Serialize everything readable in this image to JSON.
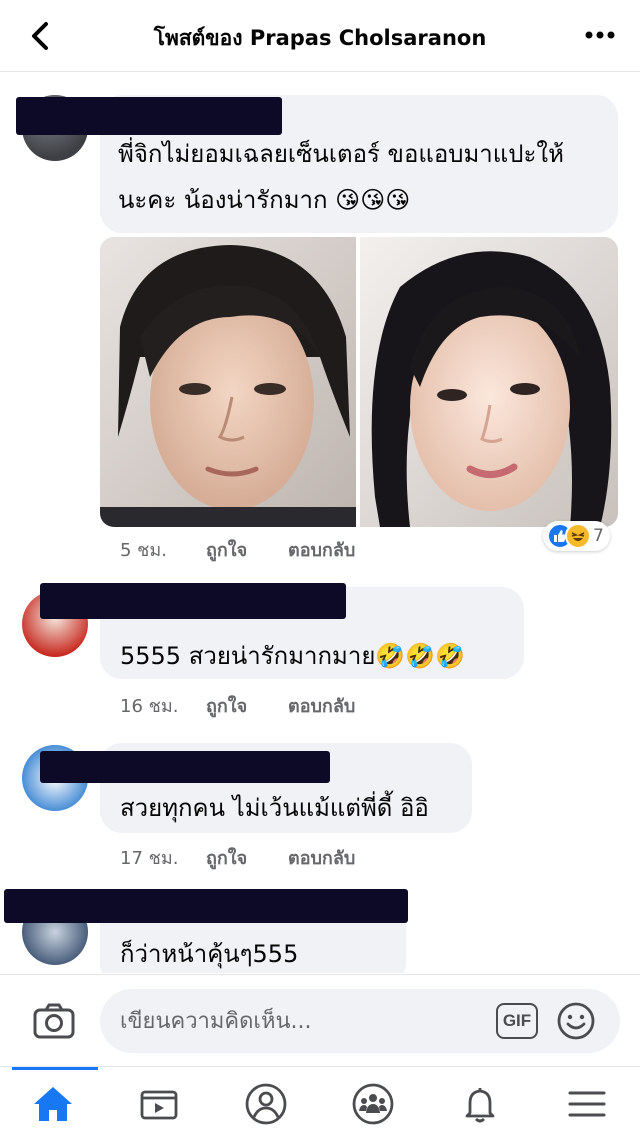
{
  "header": {
    "title": "โพสต์ของ Prapas Cholsaranon",
    "back_icon": "chevron-left-icon",
    "more_icon": "more-horizontal-icon"
  },
  "comments": [
    {
      "text_line1": "พี่จิกไม่ยอมเฉลยเซ็นเตอร์ ขอแอบมาแปะให้",
      "text_line2": "นะคะ  น้องน่ารักมาก 😘😘😘",
      "time": "5 ชม.",
      "like_label": "ถูกใจ",
      "reply_label": "ตอบกลับ",
      "reaction_count": "7",
      "reaction_icons": [
        "like-reaction-icon",
        "haha-reaction-icon"
      ]
    },
    {
      "text": "5555 สวยน่ารักมากมาย🤣🤣🤣",
      "time": "16 ชม.",
      "like_label": "ถูกใจ",
      "reply_label": "ตอบกลับ"
    },
    {
      "text": "สวยทุกคน ไม่เว้นแม้แต่พี่ดี้ อิอิ",
      "time": "17 ชม.",
      "like_label": "ถูกใจ",
      "reply_label": "ตอบกลับ"
    },
    {
      "text": "ก็ว่าหน้าคุ้นๆ555"
    }
  ],
  "composer": {
    "placeholder": "เขียนความคิดเห็น...",
    "gif_label": "GIF",
    "camera_icon": "camera-icon",
    "emoji_icon": "smiley-icon"
  },
  "bottom_nav": {
    "items": [
      "home-icon",
      "video-icon",
      "profile-icon",
      "groups-icon",
      "bell-icon",
      "menu-icon"
    ],
    "active_index": 0
  },
  "colors": {
    "accent": "#1877f2",
    "bubble": "#f0f2f5",
    "meta_text": "#65676b",
    "redaction": "#0c0a26"
  }
}
